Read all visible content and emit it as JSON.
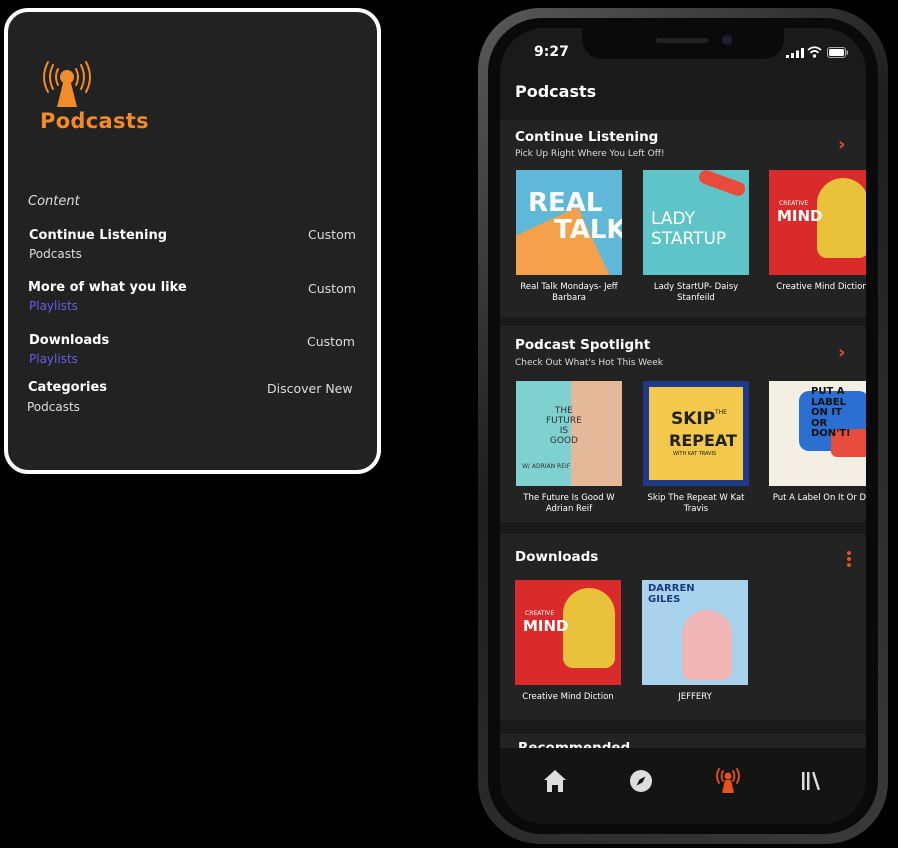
{
  "summary_card": {
    "brand_title": "Podcasts",
    "content_label": "Content",
    "rows": [
      {
        "title": "Continue Listening",
        "subtitle": "Podcasts",
        "tag": "Custom"
      },
      {
        "title": "More of what you like",
        "subtitle": "Playlists",
        "tag": "Custom"
      },
      {
        "title": "Downloads",
        "subtitle": "Playlists",
        "tag": "Custom"
      },
      {
        "title": "Categories",
        "subtitle": "Podcasts",
        "tag": "Discover New"
      }
    ]
  },
  "phone": {
    "status_time": "9:27",
    "page_title": "Podcasts",
    "continue_listening": {
      "title": "Continue Listening",
      "subtitle": "Pick Up Right Where You Left Off!",
      "items": [
        {
          "caption": "Real Talk Mondays- Jeff Barbara",
          "art_text": [
            "REAL",
            "TALK"
          ]
        },
        {
          "caption": "Lady StartUP- Daisy Stanfeild",
          "art_text": [
            "LADY",
            "STARTUP"
          ]
        },
        {
          "caption": "Creative Mind Diction",
          "art_text": [
            "CREATIVE",
            "MIND"
          ]
        }
      ]
    },
    "spotlight": {
      "title": "Podcast Spotlight",
      "subtitle": "Check Out What's Hot This Week",
      "items": [
        {
          "caption": "The Future Is Good W Adrian Reif",
          "art_text": [
            "THE",
            "FUTURE",
            "IS",
            "GOOD",
            "W/ ADRIAN REIF"
          ]
        },
        {
          "caption": "Skip The Repeat W Kat Travis",
          "art_text": [
            "SKIP",
            "THE",
            "REPEAT",
            "WITH KAT TRAVIS"
          ]
        },
        {
          "caption": "Put A Label On It Or Do",
          "art_text": [
            "PUT A",
            "LABEL",
            "ON IT",
            "OR",
            "DON'T!"
          ]
        }
      ]
    },
    "downloads": {
      "title": "Downloads",
      "items": [
        {
          "caption": "Creative Mind Diction",
          "art_text": [
            "CREATIVE",
            "MIND"
          ]
        },
        {
          "caption": "JEFFERY",
          "art_text": [
            "DARREN",
            "GILES"
          ]
        }
      ]
    },
    "recommended_title": "Recommended",
    "tabs": [
      {
        "icon": "home-icon"
      },
      {
        "icon": "compass-icon"
      },
      {
        "icon": "podcast-icon",
        "active": true
      },
      {
        "icon": "library-icon"
      }
    ]
  },
  "colors": {
    "accent_orange": "#f28b2a",
    "accent_red": "#e8501f",
    "playlist_purple": "#6c5ce7",
    "background": "#000000",
    "card": "#222222"
  }
}
